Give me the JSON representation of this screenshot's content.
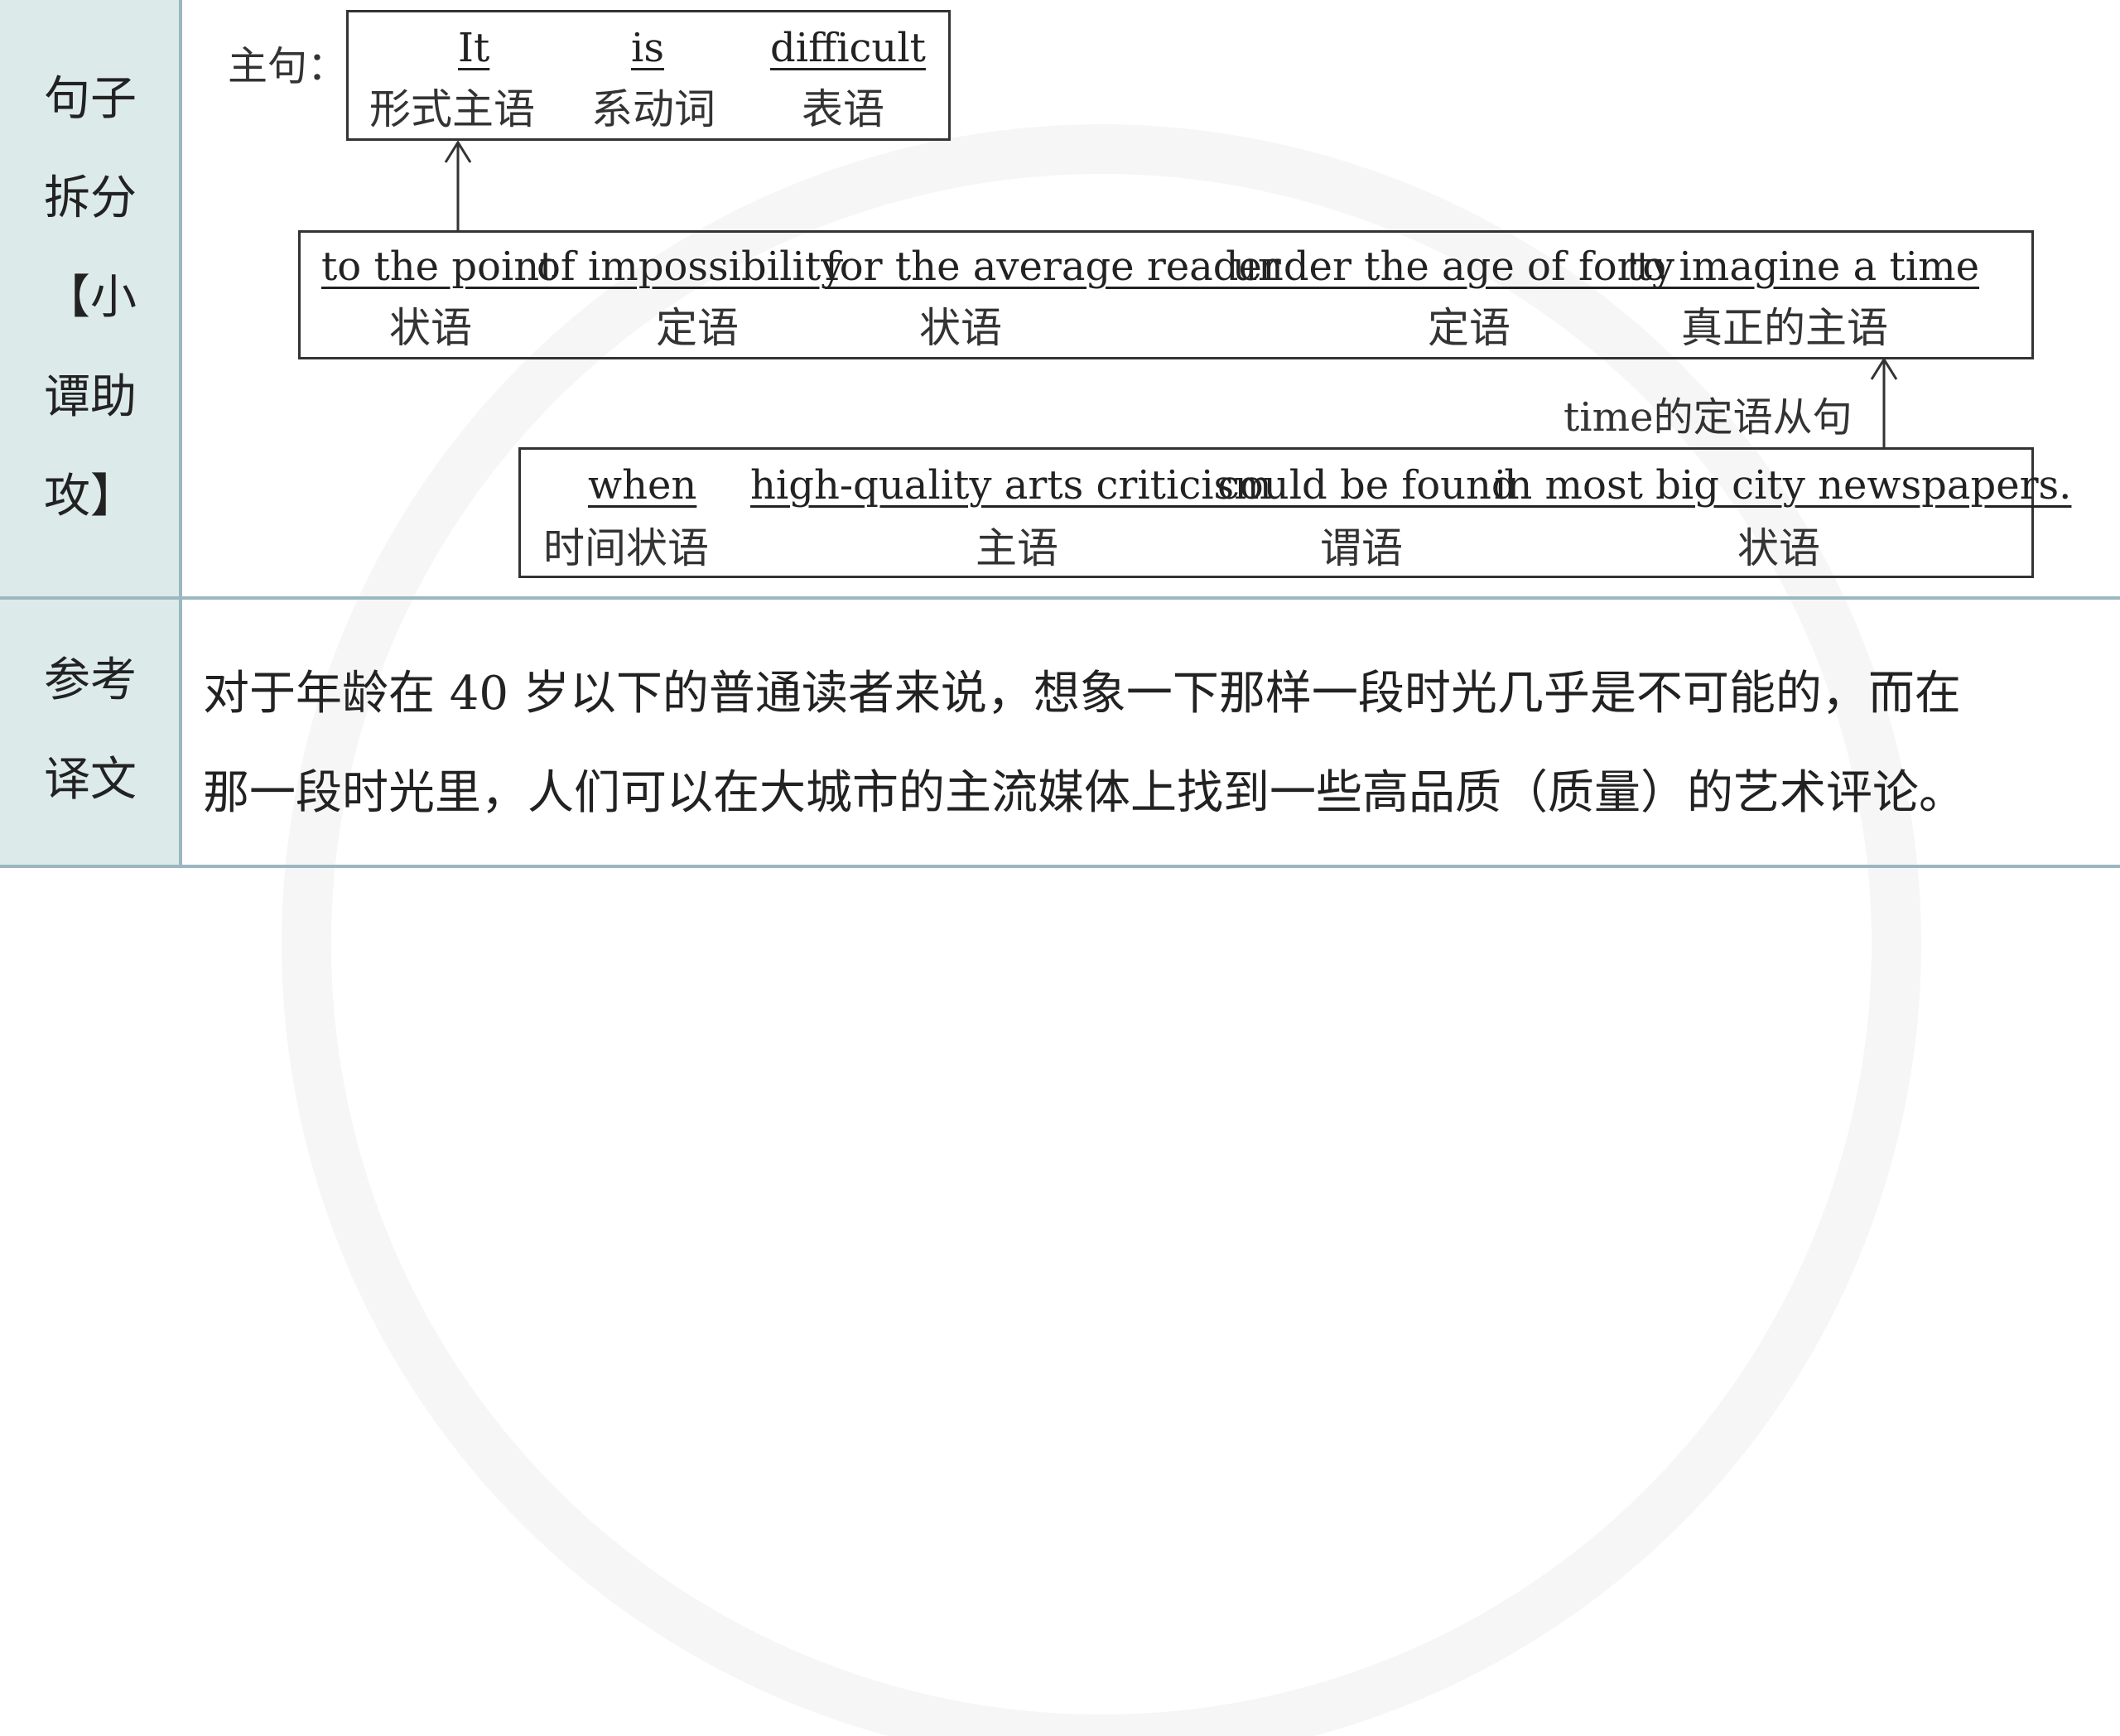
{
  "left_labels": {
    "split_lines": [
      "句子",
      "拆分",
      "【小",
      "谭助",
      "攻】"
    ],
    "translation_lines": [
      "参考",
      "译文"
    ]
  },
  "main_clause": {
    "label": "主句：",
    "words": [
      {
        "en": "It",
        "cn": "形式主语"
      },
      {
        "en": "is",
        "cn": "系动词"
      },
      {
        "en": "difficult",
        "cn": "表语"
      }
    ]
  },
  "infinitive_box": {
    "words": [
      {
        "en": "to the point",
        "cn": "状语"
      },
      {
        "en": "of impossibility",
        "cn": "定语"
      },
      {
        "en": "for the average reader",
        "cn": "状语"
      },
      {
        "en": "under the age of forty",
        "cn": "定语"
      },
      {
        "en": "to imagine a time",
        "cn": "真正的主语"
      }
    ]
  },
  "relative_clause": {
    "label": "time的定语从句",
    "words": [
      {
        "en": "when",
        "cn": "时间状语"
      },
      {
        "en": "high-quality arts criticism",
        "cn": "主语"
      },
      {
        "en": "could be found",
        "cn": "谓语"
      },
      {
        "en": "in most big city newspapers.",
        "cn": "状语"
      }
    ]
  },
  "translation": {
    "line1": "对于年龄在 40 岁以下的普通读者来说，想象一下那样一段时光几乎是不可能的，而在",
    "line2": "那一段时光里，人们可以在大城市的主流媒体上找到一些高品质（质量）的艺术评论。"
  }
}
